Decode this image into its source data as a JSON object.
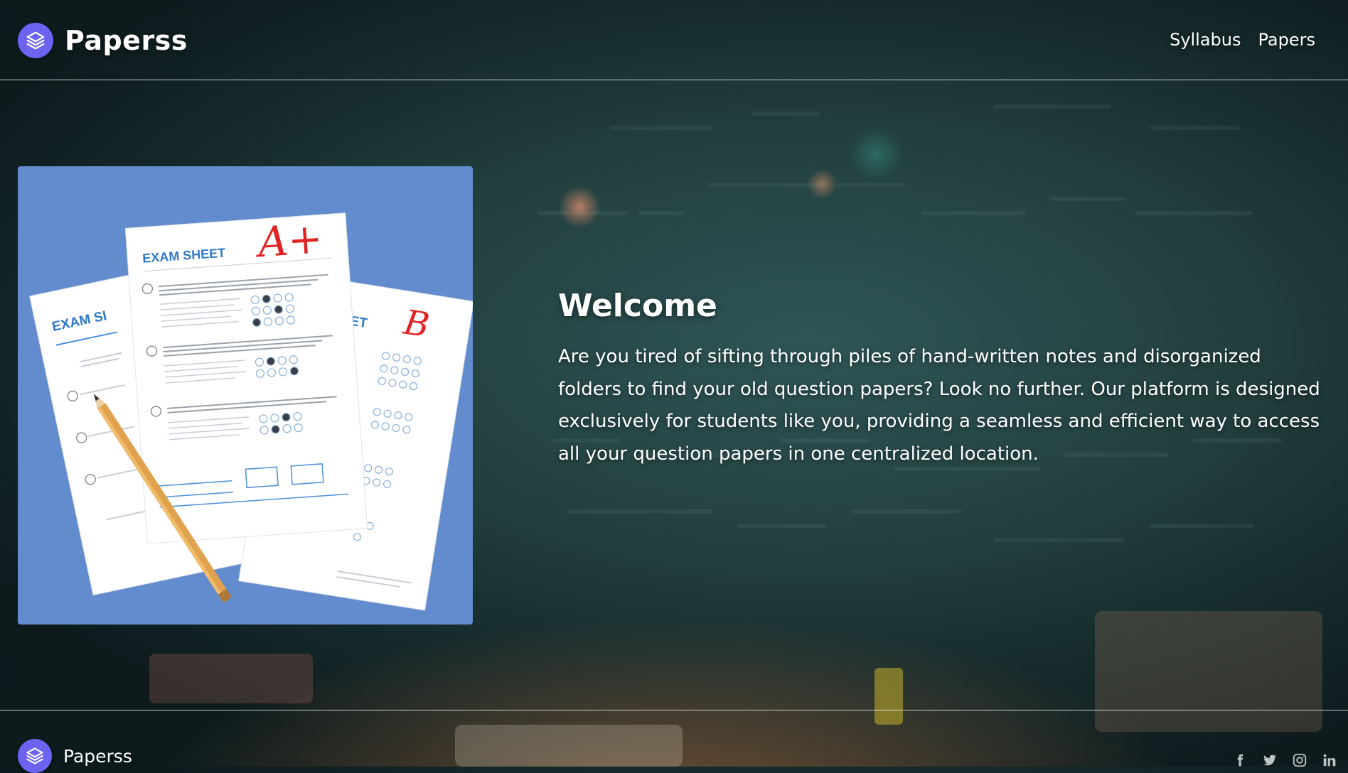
{
  "navbar": {
    "brand": "Paperss",
    "logo_icon": "layers-icon",
    "links": [
      "Syllabus",
      "Papers"
    ]
  },
  "hero": {
    "illustration": {
      "sheet_title": "EXAM SHEET",
      "sheet_title_partial_left": "EXAM SI",
      "sheet_title_partial_right": "EET",
      "grade_front": "A+",
      "grade_back": "B"
    },
    "title": "Welcome",
    "text": "Are you tired of sifting through piles of hand-written notes and disorganized folders to find your old question papers? Look no further. Our platform is designed exclusively for students like you, providing a seamless and efficient way to access all your question papers in one centralized location."
  },
  "footer": {
    "brand": "Paperss",
    "social_icons": [
      "facebook-icon",
      "twitter-icon",
      "instagram-icon",
      "linkedin-icon"
    ]
  },
  "colors": {
    "accent": "#6e63f0",
    "card_background": "#628cce",
    "sheet_blue": "#2e79c7",
    "grade_red": "#e02424"
  }
}
